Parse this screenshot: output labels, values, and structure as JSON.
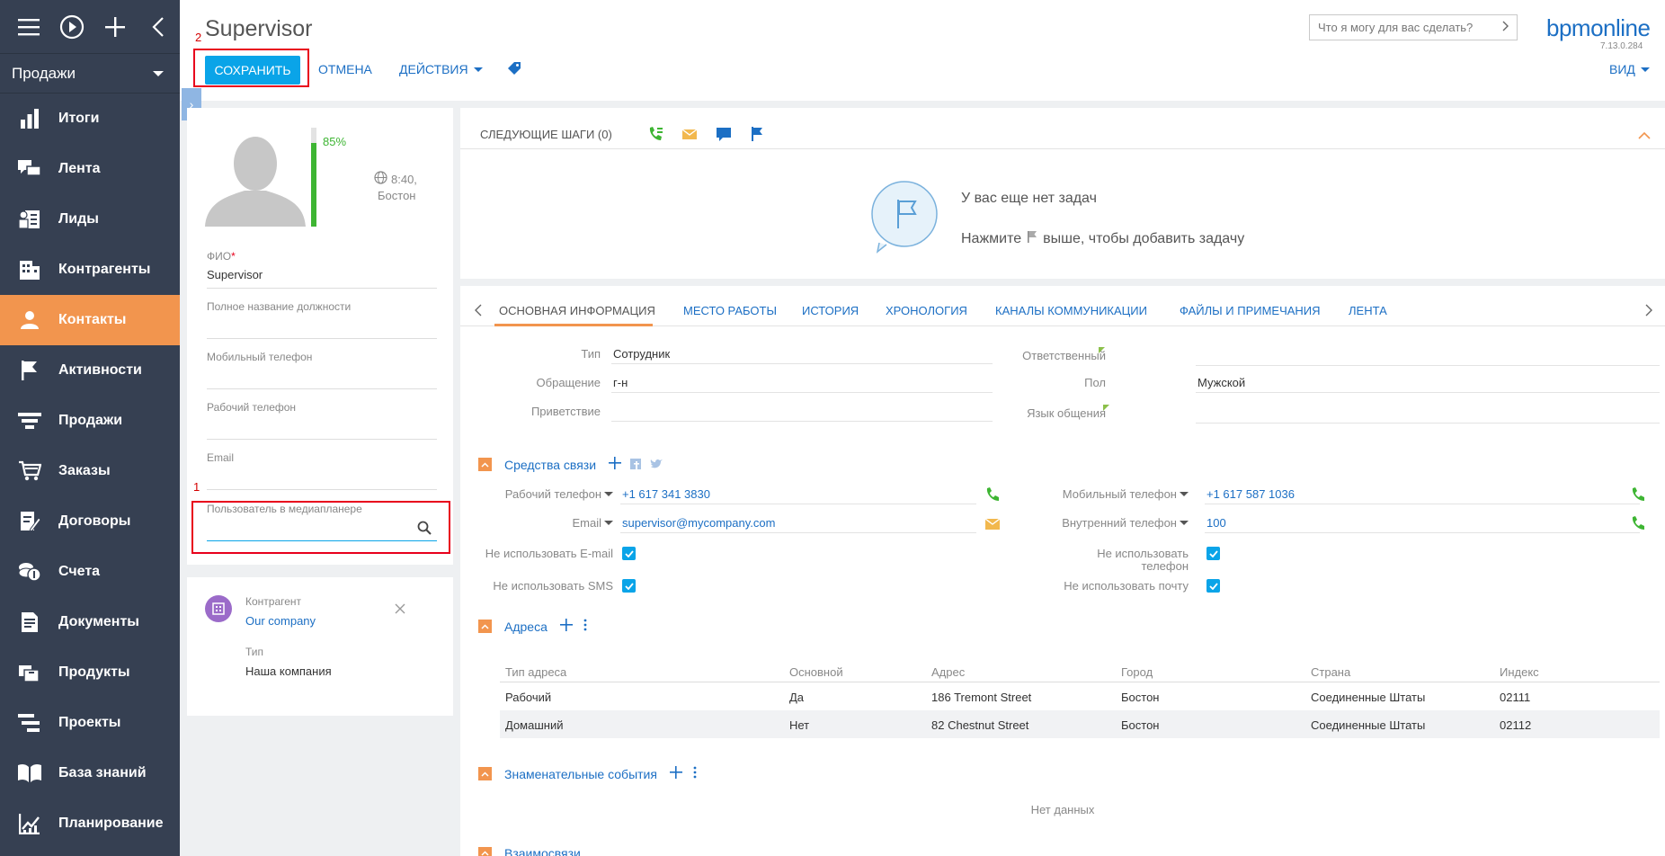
{
  "sidebar": {
    "section_selected": "Продажи",
    "items": [
      {
        "label": "Итоги",
        "icon": "bar-chart-icon"
      },
      {
        "label": "Лента",
        "icon": "chat-icon"
      },
      {
        "label": "Лиды",
        "icon": "leads-icon"
      },
      {
        "label": "Контрагенты",
        "icon": "building-icon"
      },
      {
        "label": "Контакты",
        "icon": "person-icon",
        "active": true
      },
      {
        "label": "Активности",
        "icon": "flag-icon"
      },
      {
        "label": "Продажи",
        "icon": "funnel-icon"
      },
      {
        "label": "Заказы",
        "icon": "cart-icon"
      },
      {
        "label": "Договоры",
        "icon": "contract-icon"
      },
      {
        "label": "Счета",
        "icon": "coins-icon"
      },
      {
        "label": "Документы",
        "icon": "document-icon"
      },
      {
        "label": "Продукты",
        "icon": "products-icon"
      },
      {
        "label": "Проекты",
        "icon": "projects-icon"
      },
      {
        "label": "База знаний",
        "icon": "book-icon"
      },
      {
        "label": "Планирование",
        "icon": "planning-icon"
      }
    ]
  },
  "header": {
    "title": "Supervisor",
    "save_label": "СОХРАНИТЬ",
    "cancel_label": "ОТМЕНА",
    "actions_label": "ДЕЙСТВИЯ",
    "search_placeholder": "Что я могу для вас сделать?",
    "brand": "bpmonline",
    "version": "7.13.0.284",
    "view_label": "ВИД",
    "marker_2": "2"
  },
  "profile": {
    "completeness": "85%",
    "completeness_fraction": 0.85,
    "time": "8:40,",
    "city": "Бостон",
    "fields": {
      "fio_label": "ФИО",
      "fio_value": "Supervisor",
      "job_label": "Полное название должности",
      "mobile_label": "Мобильный телефон",
      "work_label": "Рабочий телефон",
      "email_label": "Email",
      "media_label": "Пользователь в медиапланере",
      "marker_1": "1"
    }
  },
  "account_card": {
    "account_label": "Контрагент",
    "account_value": "Our company",
    "type_label": "Тип",
    "type_value": "Наша компания"
  },
  "next_steps": {
    "title": "СЛЕДУЮЩИЕ ШАГИ (0)",
    "empty_title": "У вас еще нет задач",
    "hint_before": "Нажмите",
    "hint_after": "выше, чтобы добавить задачу"
  },
  "tabs": [
    "ОСНОВНАЯ ИНФОРМАЦИЯ",
    "МЕСТО РАБОТЫ",
    "ИСТОРИЯ",
    "ХРОНОЛОГИЯ",
    "КАНАЛЫ КОММУНИКАЦИИ",
    "ФАЙЛЫ И ПРИМЕЧАНИЯ",
    "ЛЕНТА"
  ],
  "main_info": {
    "type_label": "Тип",
    "type_value": "Сотрудник",
    "salutation_label": "Обращение",
    "salutation_value": "г-н",
    "greeting_label": "Приветствие",
    "owner_label": "Ответственный",
    "gender_label": "Пол",
    "gender_value": "Мужской",
    "language_label": "Язык общения"
  },
  "communication": {
    "title": "Средства связи",
    "work_phone_label": "Рабочий телефон",
    "work_phone_value": "+1 617 341 3830",
    "mobile_label": "Мобильный телефон",
    "mobile_value": "+1 617 587 1036",
    "email_label": "Email",
    "email_value": "supervisor@mycompany.com",
    "internal_label": "Внутренний телефон",
    "internal_value": "100",
    "no_email_label": "Не использовать E-mail",
    "no_phone_label_1": "Не использовать",
    "no_phone_label_2": "телефон",
    "no_sms_label": "Не использовать SMS",
    "no_mail_label": "Не использовать почту"
  },
  "addresses": {
    "title": "Адреса",
    "columns": [
      "Тип адреса",
      "Основной",
      "Адрес",
      "Город",
      "Страна",
      "Индекс"
    ],
    "rows": [
      [
        "Рабочий",
        "Да",
        "186 Tremont Street",
        "Бостон",
        "Соединенные Штаты",
        "02111"
      ],
      [
        "Домашний",
        "Нет",
        "82 Chestnut Street",
        "Бостон",
        "Соединенные Штаты",
        "02112"
      ]
    ]
  },
  "events": {
    "title": "Знаменательные события",
    "empty": "Нет данных"
  },
  "relations": {
    "title": "Взаимосвязи"
  },
  "colors": {
    "accent": "#f2954e",
    "primary": "#0aa4e8",
    "sidebar": "#364052",
    "link": "#1c6fc4"
  }
}
